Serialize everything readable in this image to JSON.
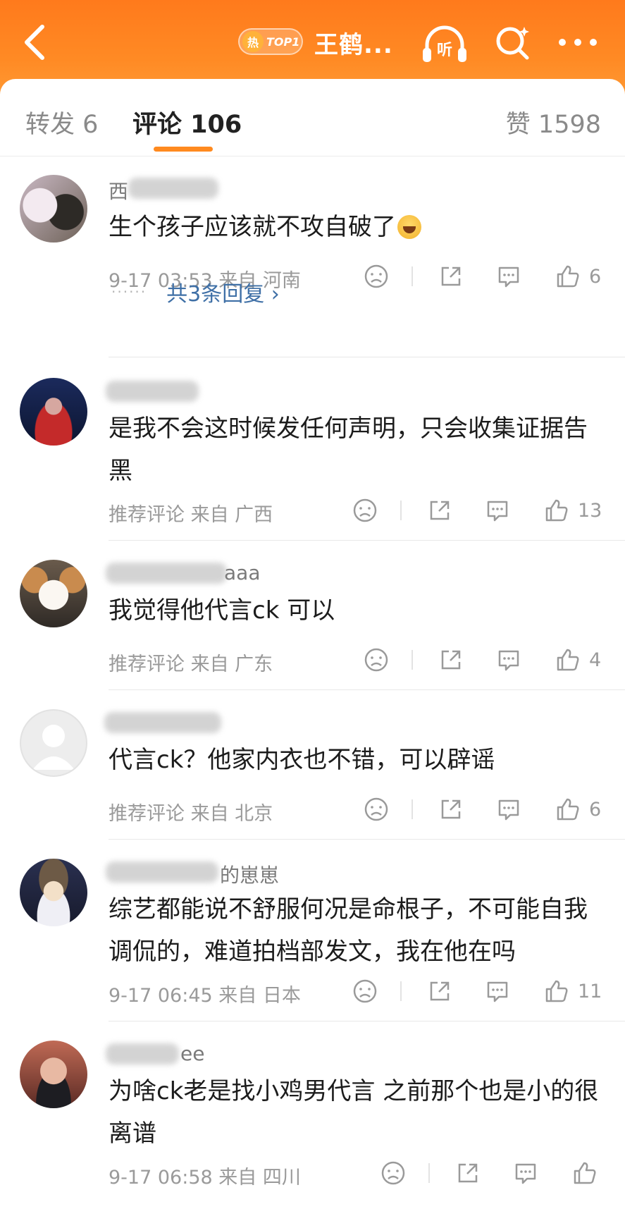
{
  "header": {
    "hot_char": "热",
    "hot_rank": "TOP1",
    "title": "王鹤...",
    "listen_label": "听"
  },
  "tabs": {
    "repost": "转发 6",
    "comments": "评论 106",
    "likes": "赞 1598"
  },
  "colors": {
    "header_orange": "#ff7a1c",
    "accent": "#ff8a1f",
    "link_blue": "#3e6fa6"
  },
  "comments": [
    {
      "username": "西",
      "content": "生个孩子应该就不攻自破了",
      "meta": "9-17 03:53  来自 河南",
      "likes": "6",
      "replies": "共3条回复 ›",
      "emoji": "laugh-cry-emoji"
    },
    {
      "username": "",
      "content": "是我不会这时候发任何声明，只会收集证据告黑",
      "meta": "推荐评论  来自 广西",
      "likes": "13"
    },
    {
      "username": "aaa",
      "content": "我觉得他代言ck 可以",
      "meta": "推荐评论  来自 广东",
      "likes": "4"
    },
    {
      "username": "",
      "content": "代言ck？他家内衣也不错，可以辟谣",
      "meta": "推荐评论  来自 北京",
      "likes": "6"
    },
    {
      "username": "的崽崽",
      "content": "综艺都能说不舒服何况是命根子，不可能自我调侃的，难道拍档部发文，我在他在吗",
      "meta": "9-17 06:45  来自 日本",
      "likes": "11"
    },
    {
      "username": "ee",
      "content": "为啥ck老是找小鸡男代言  之前那个也是小的很离谱",
      "meta": "9-17 06:58  来自 四川",
      "likes": ""
    }
  ]
}
